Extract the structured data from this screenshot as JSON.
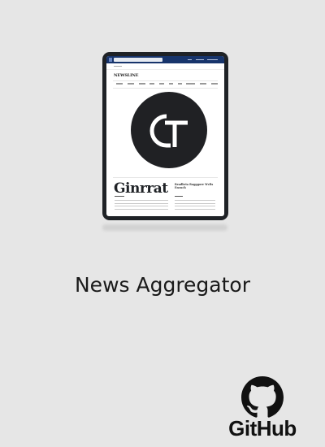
{
  "mockup": {
    "headline": "Ginrrat",
    "side_headline": "Readbrta Ragggore Wclis Encnch",
    "logo_letters": "GT"
  },
  "title": "News Aggregator",
  "github": {
    "label": "GitHub",
    "icon": "github-octocat-icon"
  },
  "colors": {
    "background": "#e6e6e6",
    "tablet_frame": "#1f2226",
    "topbar": "#17346b",
    "logo_circle": "#202124"
  }
}
